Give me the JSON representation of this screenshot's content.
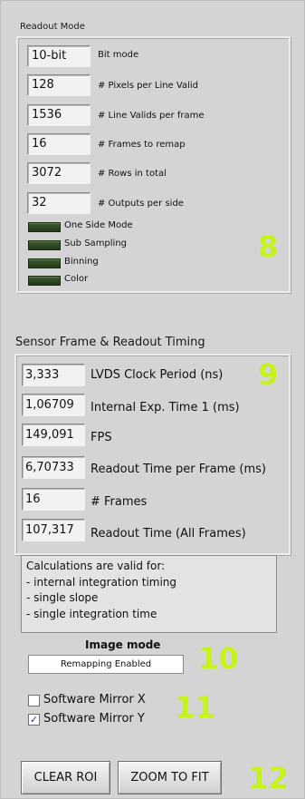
{
  "readout": {
    "title": "Readout Mode",
    "fields": [
      {
        "value": "10-bit",
        "label": "Bit mode"
      },
      {
        "value": "128",
        "label": "# Pixels per Line Valid"
      },
      {
        "value": "1536",
        "label": "# Line Valids per frame"
      },
      {
        "value": "16",
        "label": "# Frames to remap"
      },
      {
        "value": "3072",
        "label": "# Rows in total"
      },
      {
        "value": "32",
        "label": "# Outputs per side"
      }
    ],
    "leds": [
      "One Side Mode",
      "Sub Sampling",
      "Binning",
      "Color"
    ],
    "annotation": "8"
  },
  "timing": {
    "title": "Sensor Frame & Readout Timing",
    "fields": [
      {
        "value": "3,333",
        "label": "LVDS Clock Period (ns)"
      },
      {
        "value": "1,06709",
        "label": "Internal Exp. Time 1 (ms)"
      },
      {
        "value": "149,091",
        "label": "FPS"
      },
      {
        "value": "6,70733",
        "label": "Readout Time per Frame (ms)"
      },
      {
        "value": "16",
        "label": "# Frames"
      },
      {
        "value": "107,317",
        "label": "Readout Time (All Frames)"
      }
    ],
    "annotation": "9"
  },
  "note": {
    "lines": [
      "Calculations are valid for:",
      "- internal integration timing",
      "- single slope",
      "- single integration time"
    ]
  },
  "image_mode": {
    "title": "Image mode",
    "value": "Remapping Enabled",
    "annotation": "10"
  },
  "mirror": {
    "x_label": "Software Mirror X",
    "x_checked": false,
    "y_label": "Software Mirror Y",
    "y_checked": true,
    "check_glyph": "✓",
    "annotation": "11"
  },
  "buttons": {
    "clear_roi": "CLEAR ROI",
    "zoom_to_fit": "ZOOM TO FIT",
    "annotation": "12"
  },
  "colors": {
    "annotation": "#c6f31c",
    "led_off": "#2f4a25",
    "panel": "#d4d4d4"
  }
}
